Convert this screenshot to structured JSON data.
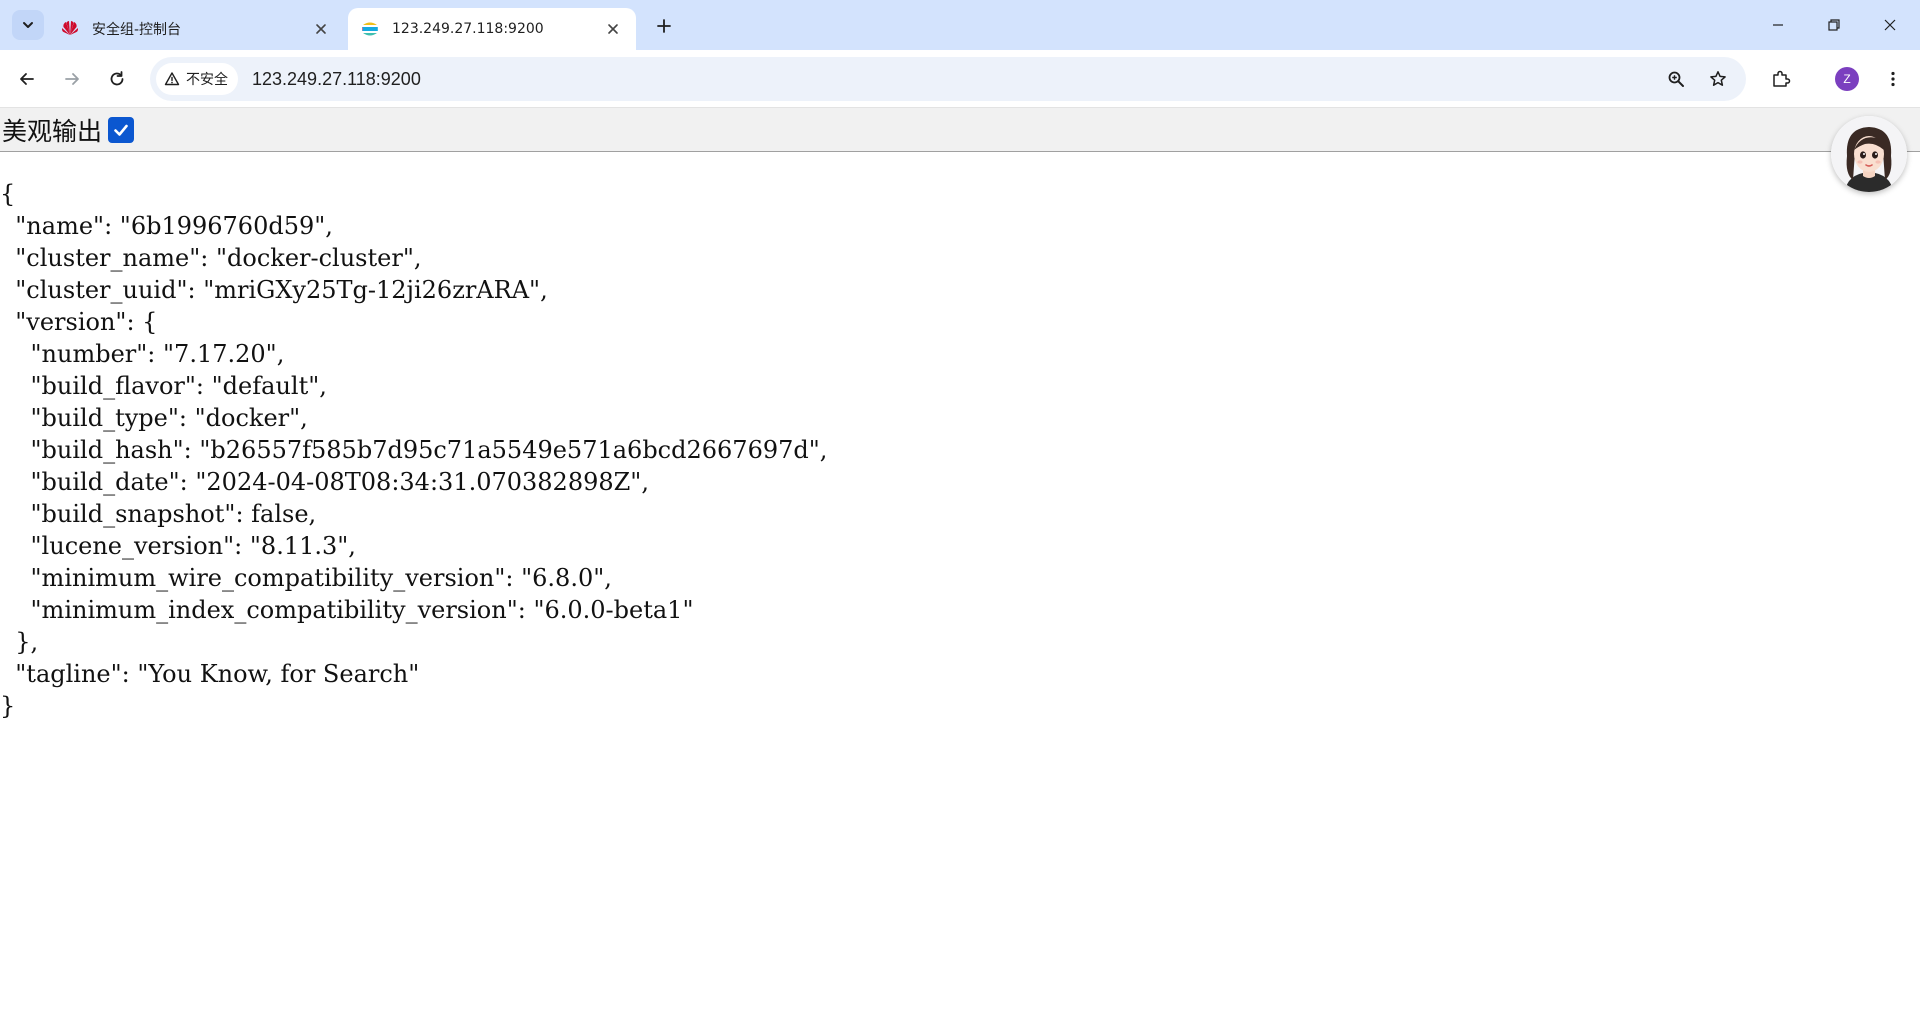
{
  "browser": {
    "tabs": [
      {
        "title": "安全组-控制台",
        "favicon": "huawei-logo-icon",
        "active": false
      },
      {
        "title": "123.249.27.118:9200",
        "favicon": "elasticsearch-logo-icon",
        "active": true
      }
    ],
    "address": {
      "security_label": "不安全",
      "url": "123.249.27.118:9200"
    },
    "profile_initial": "Z"
  },
  "pretty_print": {
    "label": "美观输出",
    "checked": true
  },
  "json_lines": [
    "{",
    "  \"name\": \"6b1996760d59\",",
    "  \"cluster_name\": \"docker-cluster\",",
    "  \"cluster_uuid\": \"mriGXy25Tg-12ji26zrARA\",",
    "  \"version\": {",
    "    \"number\": \"7.17.20\",",
    "    \"build_flavor\": \"default\",",
    "    \"build_type\": \"docker\",",
    "    \"build_hash\": \"b26557f585b7d95c71a5549e571a6bcd2667697d\",",
    "    \"build_date\": \"2024-04-08T08:34:31.070382898Z\",",
    "    \"build_snapshot\": false,",
    "    \"lucene_version\": \"8.11.3\",",
    "    \"minimum_wire_compatibility_version\": \"6.8.0\",",
    "    \"minimum_index_compatibility_version\": \"6.0.0-beta1\"",
    "  },",
    "  \"tagline\": \"You Know, for Search\"",
    "}"
  ],
  "colors": {
    "tabstrip_bg": "#d3e3fd",
    "omnibox_bg": "#edf2fa",
    "checkbox_accent": "#0b57d0",
    "profile_avatar": "#7b3fbf"
  }
}
